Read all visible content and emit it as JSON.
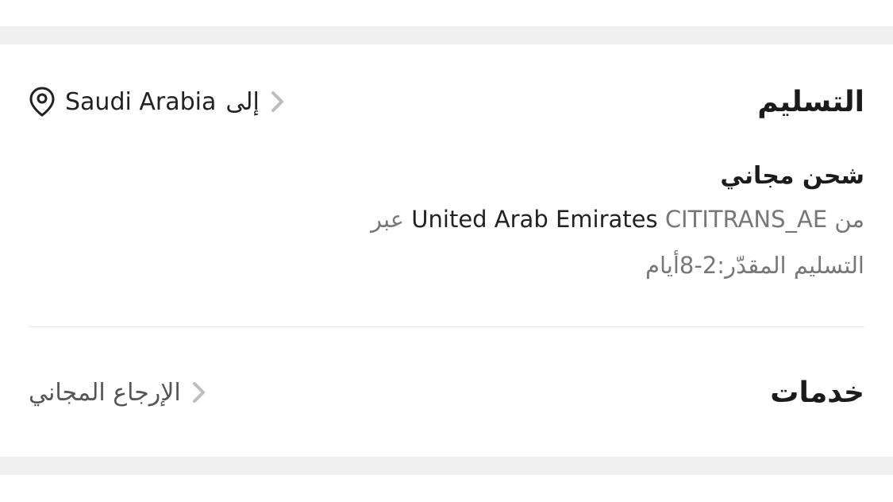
{
  "delivery": {
    "title": "التسليم",
    "to_prefix": "إلى",
    "to_country": "Saudi Arabia",
    "icons": {
      "location": "location-pin-icon",
      "chevron": "chevron-right-icon"
    },
    "shipping": {
      "method": "شحن مجاني",
      "from_prefix": "من",
      "carrier": "CITITRANS_AE",
      "origin": "United Arab Emirates",
      "via": "عبر",
      "estimate": "التسليم المقدّر:2-8أيام"
    }
  },
  "services": {
    "title": "خدمات",
    "free_return": "الإرجاع المجاني"
  },
  "colors": {
    "section_separator": "#f0f0f0",
    "chevron": "#bdbdbd",
    "muted_text": "#777777"
  }
}
